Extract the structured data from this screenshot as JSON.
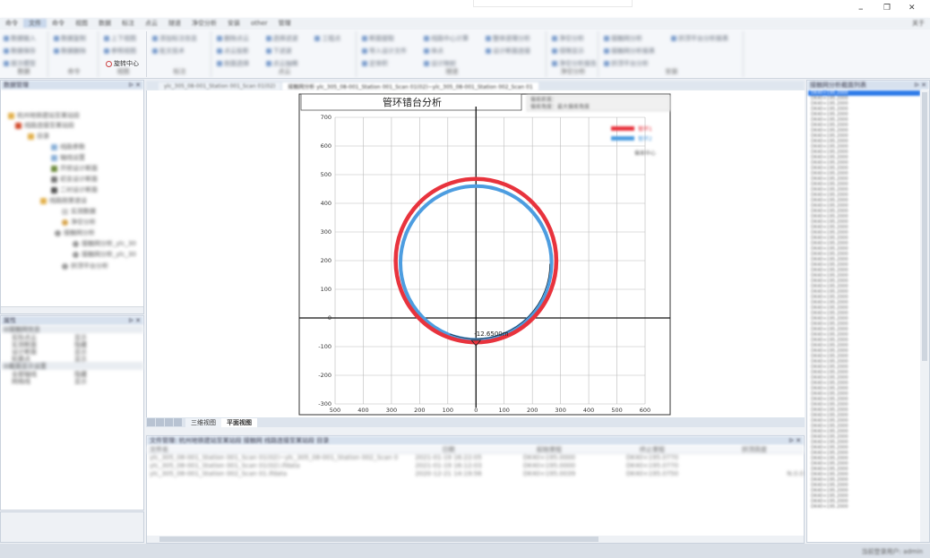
{
  "window": {
    "title": "",
    "controls": {
      "minimize": "–",
      "restore": "❐",
      "close": "✕"
    }
  },
  "menu": {
    "items": [
      "命令",
      "文件",
      "命令",
      "视图",
      "数据",
      "标注",
      "点云",
      "隧道",
      "净空分析",
      "安装",
      "other",
      "管理"
    ],
    "help": "关于"
  },
  "ribbon": {
    "groups": [
      {
        "label": "数据",
        "items": [
          "数据输入",
          "数据保存",
          "层次模型"
        ]
      },
      {
        "label": "命令",
        "items": [
          "数据复制",
          "数据删除"
        ]
      },
      {
        "label": "视图",
        "items": [
          "上下视图",
          "参照视图",
          "旋转中心"
        ]
      },
      {
        "label": "标注",
        "items": [
          "添加标注信息",
          "批文技术"
        ]
      },
      {
        "label": "点云",
        "items": [
          "删除点云",
          "点云投影",
          "剖面选择",
          "选择滤波",
          "下滤波",
          "点云抽稀",
          "工程点"
        ]
      },
      {
        "label": "隧道",
        "items": [
          "断面提取",
          "导入设计文件",
          "定体积",
          "线路中心计算",
          "体点",
          "设计映射",
          "整体道理分析",
          "设计断面连接"
        ]
      },
      {
        "label": "净空分析",
        "items": [
          "净空分析",
          "侵限显示",
          "净空分析报告"
        ]
      },
      {
        "label": "安装",
        "items": [
          "接触网分析",
          "接触网分析报表",
          "拱顶平台分析",
          "拱顶平台分析报表"
        ]
      }
    ],
    "rotation_center": "旋转中心"
  },
  "left_panel": {
    "title": "数据管理",
    "tree": [
      "杭州地铁建站至某站段",
      "线路连接至某站段",
      "目录",
      "线路参数",
      "轴线设置",
      "开挖设计断面",
      "初支设计断面",
      "二衬设计断面",
      "线路刚里道设",
      "实测数据",
      "净空分析",
      "接触网分析",
      "接触网分析_ylc_30",
      "接触网分析_ylc_30",
      "拱顶平台分析"
    ]
  },
  "props_panel": {
    "title": "属性",
    "categories": [
      {
        "name": "接触网信息",
        "rows": [
          [
            "实际点云",
            "显示"
          ],
          [
            "实测断面",
            "隐藏"
          ],
          [
            "设计断面",
            "显示"
          ],
          [
            "轮廓点",
            "显示"
          ]
        ]
      },
      {
        "name": "截面显示设置",
        "rows": [
          [
            "全部轴线",
            "隐藏"
          ],
          [
            "网格线",
            "显示"
          ]
        ]
      }
    ]
  },
  "doc_tabs": [
    "ylc_305_08-001_Station 001_Scan 01(02)",
    "接触网分析 ylc_305_08-001_Station 001_Scan 01(02)~ylc_305_08-001_Station 002_Scan 01"
  ],
  "chart_data": {
    "type": "scatter",
    "title": "管环错台分析",
    "xlim": [
      -500,
      600
    ],
    "ylim": [
      -300,
      700
    ],
    "x_ticks": [
      -500,
      -400,
      -300,
      -200,
      -100,
      0,
      100,
      200,
      300,
      400,
      500,
      600
    ],
    "y_ticks": [
      700,
      600,
      500,
      400,
      300,
      200,
      100,
      0,
      -100,
      -200,
      -300
    ],
    "x_tick_labels": [
      "500",
      "400",
      "300",
      "200",
      "100",
      "0",
      "100",
      "200",
      "300",
      "400",
      "500",
      "600"
    ],
    "y_tick_labels": [
      "700",
      "600",
      "500",
      "400",
      "300",
      "200",
      "100",
      "0",
      "-100",
      "-200",
      "-300"
    ],
    "annotation": "-12.6500m",
    "grid": true,
    "legend": "top-right",
    "series": [
      {
        "name": "管环1",
        "color": "#e8333d",
        "center": [
          0,
          200
        ],
        "radius": 285
      },
      {
        "name": "管环2",
        "color": "#4d9de0",
        "center": [
          0,
          192
        ],
        "radius": 268
      }
    ],
    "legend_extra": "偏差中心",
    "info_lines": [
      "偏差距离：",
      "偏差角度：最大偏差角度"
    ]
  },
  "view_tabs": [
    "三维视图",
    "平面视图"
  ],
  "right_panel": {
    "title": "接触网分析截面列表",
    "items": [
      "DK40+195.2000",
      "DK40+195.2000",
      "DK40+195.2000",
      "DK40+195.2000",
      "DK40+195.2000",
      "DK40+195.2000",
      "DK40+195.2000",
      "DK40+195.2000",
      "DK40+195.2000",
      "DK40+195.2000",
      "DK40+195.2000",
      "DK40+195.2000",
      "DK40+195.2000",
      "DK40+195.2000",
      "DK40+195.2000",
      "DK40+195.2000",
      "DK40+195.2000",
      "DK40+195.2000",
      "DK40+195.2000",
      "DK40+195.2000",
      "DK40+195.2000",
      "DK40+195.2000",
      "DK40+195.2000",
      "DK40+195.2000",
      "DK40+195.2000",
      "DK40+195.2000",
      "DK40+195.2000",
      "DK40+195.2000",
      "DK40+195.2000",
      "DK40+195.2000",
      "DK40+195.2000",
      "DK40+195.2000",
      "DK40+195.2000",
      "DK40+195.2000",
      "DK40+195.2000",
      "DK40+195.2000",
      "DK40+195.2000",
      "DK40+195.2000",
      "DK40+195.2000",
      "DK40+195.2000",
      "DK40+195.2000",
      "DK40+195.2000",
      "DK40+195.2000",
      "DK40+195.2000",
      "DK40+195.2000",
      "DK40+195.2000",
      "DK40+195.2000",
      "DK40+195.2000",
      "DK40+195.2000",
      "DK40+195.2000",
      "DK40+195.2000",
      "DK40+195.2000",
      "DK40+195.2000",
      "DK40+195.2000",
      "DK40+195.2000",
      "DK40+195.2000",
      "DK40+195.2000",
      "DK40+195.2000",
      "DK40+195.2000",
      "DK40+195.2000",
      "DK40+195.2000",
      "DK40+195.2000",
      "DK40+195.2000",
      "DK40+195.2000",
      "DK40+195.2000",
      "DK40+195.2000",
      "DK40+195.2000",
      "DK40+195.2000",
      "DK40+195.2000",
      "DK40+195.2000",
      "DK40+195.2000",
      "DK40+195.2000",
      "DK40+195.2000",
      "DK40+195.2000",
      "DK40+195.2000",
      "DK40+195.2000",
      "DK40+195.2000",
      "DK40+195.2000"
    ]
  },
  "file_panel": {
    "title": "文件管理: 杭州地铁建站至某站段 接触网 线路连接至某站段 目录",
    "columns": [
      "文件名",
      "日期",
      "起始里程",
      "终止里程",
      "拱顶高度"
    ],
    "rows": [
      [
        "ylc_305_08-001_Station 001_Scan 01(02)~ylc_305_08-001_Station 002_Scan 01.ifdata",
        "2021-01-19 16:22:05",
        "DK40+195.0000",
        "DK40+195.0770",
        ""
      ],
      [
        "ylc_305_08-001_Station 001_Scan 01(02).ifdata",
        "2021-01-19 16:12:03",
        "DK40+195.0000",
        "DK40+195.0770",
        ""
      ],
      [
        "ylc_305_08-001_Station 002_Scan 01.ifdata",
        "2020-12-21 14:19:56",
        "DK40+195.0039",
        "DK40+195.0750",
        "N.0.0"
      ]
    ]
  },
  "status": {
    "text": "当前登录用户: admin"
  }
}
